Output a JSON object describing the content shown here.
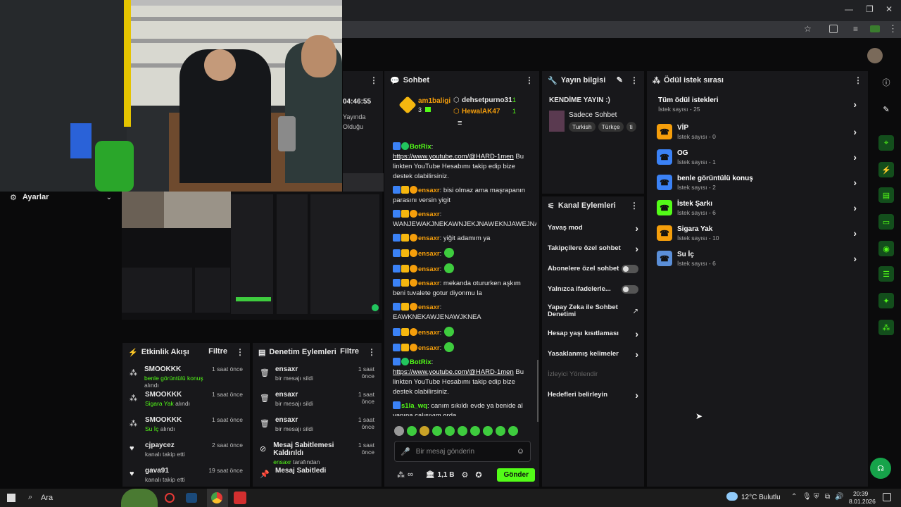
{
  "browser": {
    "controls": {
      "minimize": "—",
      "maximize": "❐",
      "close": "✕"
    }
  },
  "stream_overlay": {
    "partial_time": "04:46:55",
    "partial_text1": "Yayında",
    "partial_text2": "Olduğu"
  },
  "settings": {
    "label": "Ayarlar"
  },
  "chat": {
    "title": "Sohbet",
    "leaders": [
      {
        "name": "am1baligi",
        "count": "3"
      },
      {
        "name": "dehsetpurno31",
        "count": "1"
      },
      {
        "name": "HewalAK47",
        "count": "1"
      }
    ],
    "messages": [
      {
        "user": "BotRix",
        "link": "https://www.youtube.com/@HARD-1men",
        "text": " Bu linkten YouTube Hesabımı takip edip bize destek olabilirsiniz."
      },
      {
        "user": "ensaxr",
        "text": ": bisi olmaz ama maşrapanın parasını versin yigit"
      },
      {
        "user": "ensaxr",
        "text": ":",
        "text2": "WANJEWAKJNEKAWNJEKJNAWEKNJAWEJNAW"
      },
      {
        "user": "ensaxr",
        "text": ": yiğit adamım ya"
      },
      {
        "user": "ensaxr",
        "text": ":"
      },
      {
        "user": "ensaxr",
        "text": ":"
      },
      {
        "user": "ensaxr",
        "text": ": mekanda otururken aşkım beni tuvalete gotur diyonmu la"
      },
      {
        "user": "ensaxr",
        "text": ":",
        "text2": "EAWKNEKAWJENAWJKNEA"
      },
      {
        "user": "ensaxr",
        "text": ":"
      },
      {
        "user": "ensaxr",
        "text": ":"
      },
      {
        "user": "BotRix",
        "link": "https://www.youtube.com/@HARD-1men",
        "text": " Bu linkten YouTube Hesabımı takip edip bize destek olabilirsiniz."
      },
      {
        "user": "s1la_wq",
        "text": ": canım sıkıldı evde ya benide al yanına çalışıyım orda"
      }
    ],
    "input_placeholder": "Bir mesaj gönderin",
    "points": "∞",
    "balance": "1,1 B",
    "send": "Gönder"
  },
  "stream_info": {
    "title": "Yayın bilgisi",
    "stream_title": "KENDİME YAYIN :)",
    "category": "Sadece Sohbet",
    "tags": [
      "Turkish",
      "Türkçe",
      "ti"
    ]
  },
  "channel_actions": {
    "title": "Kanal Eylemleri",
    "items": [
      {
        "label": "Yavaş mod",
        "kind": "chevron"
      },
      {
        "label": "Takipçilere özel sohbet",
        "kind": "chevron"
      },
      {
        "label": "Abonelere özel sohbet",
        "kind": "toggle"
      },
      {
        "label": "Yalnızca ifadelerle...",
        "kind": "toggle"
      },
      {
        "label": "Yapay Zeka ile Sohbet Denetimi",
        "kind": "external"
      },
      {
        "label": "Hesap yaşı kısıtlaması",
        "kind": "chevron"
      },
      {
        "label": "Yasaklanmış kelimeler",
        "kind": "chevron"
      },
      {
        "label": "İzleyici Yönlendir",
        "kind": "disabled"
      },
      {
        "label": "Hedefleri belirleyin",
        "kind": "chevron"
      }
    ]
  },
  "rewards": {
    "title": "Ödül istek sırası",
    "all_label": "Tüm ödül istekleri",
    "all_count": "İstek sayısı - 25",
    "items": [
      {
        "name": "VİP",
        "count": "İstek sayısı - 0",
        "color": "#f59e0b"
      },
      {
        "name": "OG",
        "count": "İstek sayısı - 1",
        "color": "#3b82f6"
      },
      {
        "name": "benle görüntülü konuş",
        "count": "İstek sayısı - 2",
        "color": "#3b82f6"
      },
      {
        "name": "İstek Şarkı",
        "count": "İstek sayısı - 6",
        "color": "#53fc18"
      },
      {
        "name": "Sigara Yak",
        "count": "İstek sayısı - 10",
        "color": "#f59e0b"
      },
      {
        "name": "Su İç",
        "count": "İstek sayısı - 6",
        "color": "#5b8fd8"
      }
    ]
  },
  "activity": {
    "title": "Etkinlik Akışı",
    "filter": "Filtre",
    "items": [
      {
        "name": "SMOOKKK",
        "highlight": "benle görüntülü konuş",
        "rest": " alındı",
        "time": "1 saat önce",
        "icon": "gift"
      },
      {
        "name": "SMOOKKK",
        "highlight": "Sigara Yak",
        "rest": " alındı",
        "time": "1 saat önce",
        "icon": "gift"
      },
      {
        "name": "SMOOKKK",
        "highlight": "Su İç",
        "rest": " alındı",
        "time": "1 saat önce",
        "icon": "gift"
      },
      {
        "name": "cjpaycez",
        "highlight": "",
        "rest": "kanalı takip etti",
        "time": "2 saat önce",
        "icon": "heart"
      },
      {
        "name": "gava91",
        "highlight": "",
        "rest": "kanalı takip etti",
        "time": "19 saat önce",
        "icon": "heart"
      }
    ]
  },
  "moderation": {
    "title": "Denetim Eylemleri",
    "filter": "Filtre",
    "items": [
      {
        "name": "ensaxr",
        "sub": "bir mesajı sildi",
        "time": "1 saat önce",
        "icon": "trash"
      },
      {
        "name": "ensaxr",
        "sub": "bir mesajı sildi",
        "time": "1 saat önce",
        "icon": "trash"
      },
      {
        "name": "ensaxr",
        "sub": "bir mesajı sildi",
        "time": "1 saat önce",
        "icon": "trash"
      },
      {
        "name": "Mesaj Sabitlemesi Kaldırıldı",
        "sub_hl": "ensaxr",
        "sub": " tarafından",
        "time": "1 saat önce",
        "icon": "unpin"
      },
      {
        "name": "Mesaj Sabitledi",
        "sub": "",
        "time": "",
        "icon": "pin"
      }
    ]
  },
  "taskbar": {
    "search": "Ara",
    "weather": "12°C  Bulutlu",
    "time": "20:39",
    "date": "8.01.2026"
  }
}
